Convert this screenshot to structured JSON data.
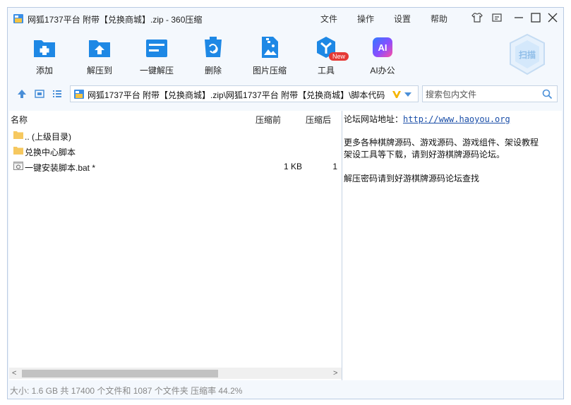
{
  "window": {
    "title": "网狐1737平台 附带【兑换商城】.zip - 360压缩",
    "menu": [
      "文件",
      "操作",
      "设置",
      "帮助"
    ]
  },
  "toolbar": {
    "tools": [
      {
        "label": "添加",
        "icon": "add-icon"
      },
      {
        "label": "解压到",
        "icon": "extract-to-icon"
      },
      {
        "label": "一键解压",
        "icon": "one-click-extract-icon"
      },
      {
        "label": "删除",
        "icon": "delete-icon"
      },
      {
        "label": "图片压缩",
        "icon": "image-compress-icon"
      },
      {
        "label": "工具",
        "icon": "tools-icon"
      },
      {
        "label": "AI办公",
        "icon": "ai-office-icon"
      }
    ],
    "new_badge": "New",
    "ai_text": "AI",
    "scan_label": "扫描"
  },
  "navbar": {
    "path": "网狐1737平台 附带【兑换商城】.zip\\网狐1737平台 附带【兑换商城】\\脚本代码",
    "search_placeholder": "搜索包内文件"
  },
  "file_list": {
    "columns": {
      "name": "名称",
      "size": "压缩前",
      "compressed": "压缩后"
    },
    "rows": [
      {
        "name": ".. (上级目录)",
        "size": "",
        "compressed": "",
        "type": "folder"
      },
      {
        "name": "兑换中心脚本",
        "size": "",
        "compressed": "",
        "type": "folder"
      },
      {
        "name": "一键安装脚本.bat *",
        "size": "1 KB",
        "compressed": "1",
        "type": "bat"
      }
    ]
  },
  "comment_pane": {
    "site_label": "论坛网站地址：",
    "site_url": "http://www.haoyou.org",
    "line2": "更多各种棋牌源码、游戏源码、游戏组件、架设教程",
    "line3": "架设工具等下载，请到好游棋牌源码论坛。",
    "line4": "解压密码请到好游棋牌源码论坛查找"
  },
  "status": {
    "text": "大小: 1.6 GB 共 17400 个文件和 1087 个文件夹 压缩率 44.2%"
  },
  "colors": {
    "accent": "#1e88e5",
    "window_bg": "#f4f8fd",
    "new_badge": "#e53935"
  }
}
